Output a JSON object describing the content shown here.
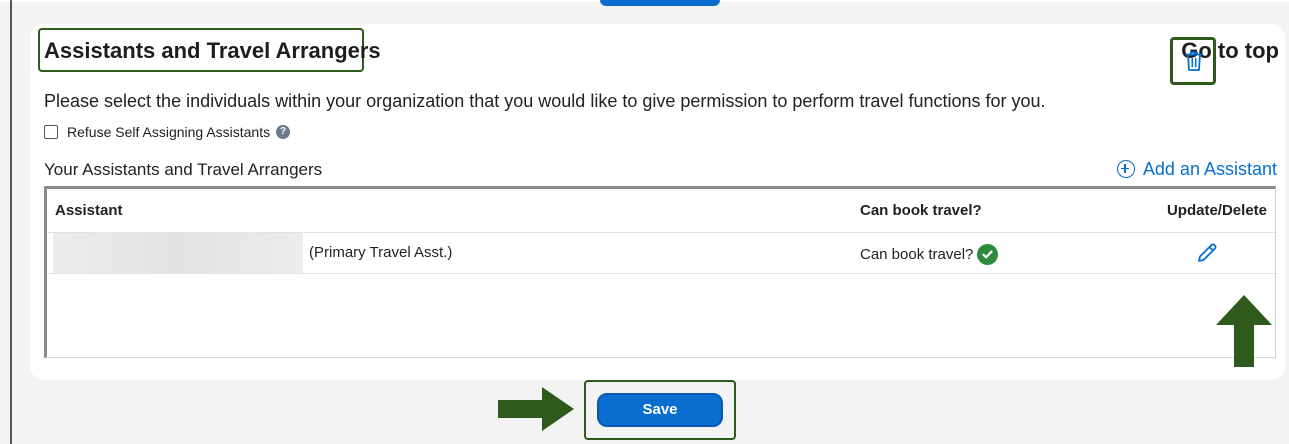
{
  "section": {
    "title": "Assistants and Travel Arrangers",
    "go_to_top": "Go to top",
    "description": "Please select the individuals within your organization that you would like to give permission to perform travel functions for you.",
    "refuse_checkbox_label": "Refuse Self Assigning Assistants",
    "refuse_checked": false,
    "help_icon": "?"
  },
  "assistants": {
    "heading": "Your Assistants and Travel Arrangers",
    "add_label": "Add an Assistant",
    "columns": {
      "assistant": "Assistant",
      "can_book": "Can book travel?",
      "update_delete": "Update/Delete"
    },
    "rows": [
      {
        "name_redacted": true,
        "role": "(Primary Travel Asst.)",
        "can_book": "Can book travel?",
        "can_book_status": "check-circle-icon"
      }
    ]
  },
  "footer": {
    "save_label": "Save"
  },
  "colors": {
    "accent_blue": "#0a6ed1",
    "success_green": "#2f8a3b",
    "annotation_green": "#2e5a1c"
  },
  "annotations": {
    "arrow_right_icon": "arrow-right-icon",
    "arrow_up_icon": "arrow-up-icon"
  }
}
